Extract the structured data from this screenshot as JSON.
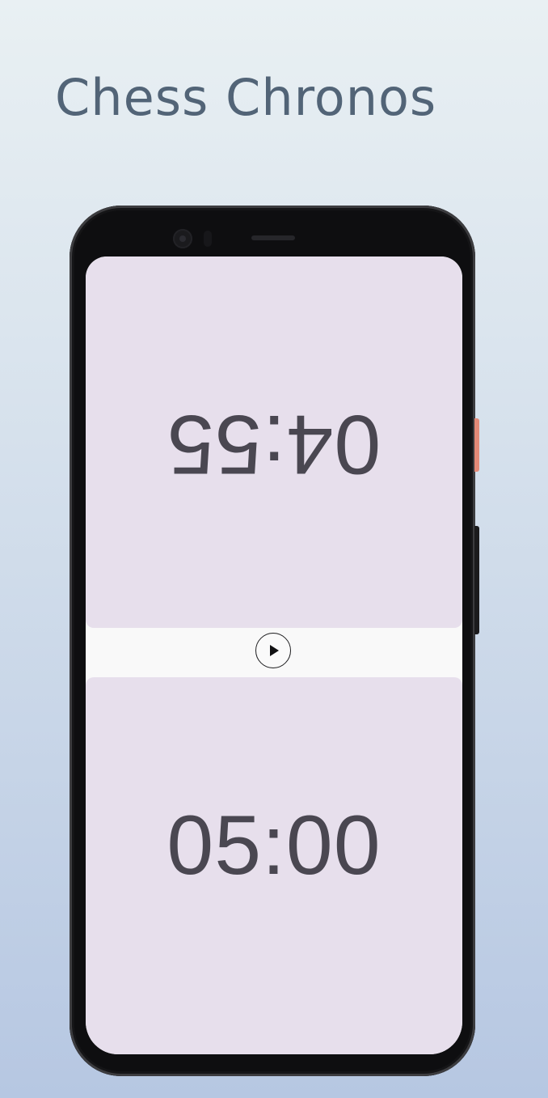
{
  "header": {
    "title": "Chess Chronos"
  },
  "timers": {
    "top": "04:55",
    "bottom": "05:00"
  },
  "controls": {
    "play_icon": "play-icon"
  },
  "colors": {
    "background_top": "#e9f0f3",
    "background_bottom": "#b6c7e2",
    "title": "#526477",
    "timer_panel": "#e7dfec",
    "timer_text": "#4a4751",
    "device_frame": "#0e0e10",
    "power_button": "#e38a78"
  }
}
